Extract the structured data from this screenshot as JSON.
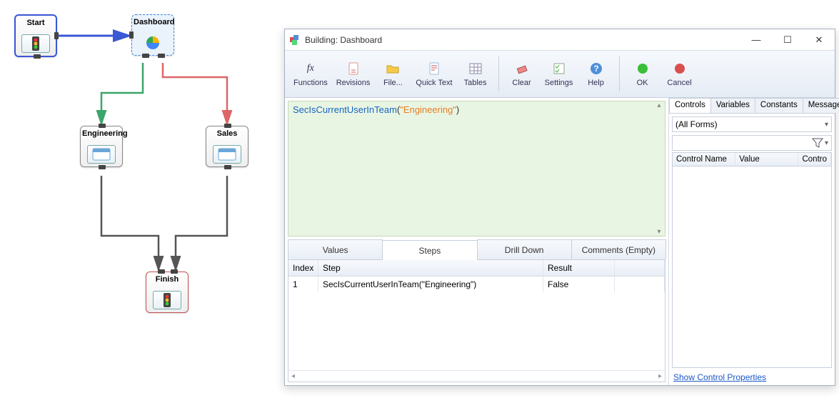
{
  "flow": {
    "nodes": {
      "start": {
        "label": "Start"
      },
      "dashboard": {
        "label": "Dashboard"
      },
      "engineering": {
        "label": "Engineering"
      },
      "sales": {
        "label": "Sales"
      },
      "finish": {
        "label": "Finish"
      }
    }
  },
  "dialog": {
    "title": "Building: Dashboard",
    "ribbon": {
      "functions": "Functions",
      "revisions": "Revisions",
      "file": "File...",
      "quicktext": "Quick Text",
      "tables": "Tables",
      "clear": "Clear",
      "settings": "Settings",
      "help": "Help",
      "ok": "OK",
      "cancel": "Cancel"
    },
    "editor": {
      "fn": "SecIsCurrentUserInTeam",
      "arg": "\"Engineering\""
    },
    "midtabs": {
      "values": "Values",
      "steps": "Steps",
      "drill": "Drill Down",
      "comments": "Comments (Empty)"
    },
    "grid": {
      "headers": {
        "index": "Index",
        "step": "Step",
        "result": "Result"
      },
      "row1": {
        "index": "1",
        "step": "SecIsCurrentUserInTeam(\"Engineering\")",
        "result": "False"
      }
    },
    "side": {
      "tabs": {
        "controls": "Controls",
        "variables": "Variables",
        "constants": "Constants",
        "messages": "Messages"
      },
      "forms": "(All Forms)",
      "cols": {
        "name": "Control Name",
        "value": "Value",
        "control": "Contro"
      },
      "link": "Show Control Properties"
    }
  }
}
